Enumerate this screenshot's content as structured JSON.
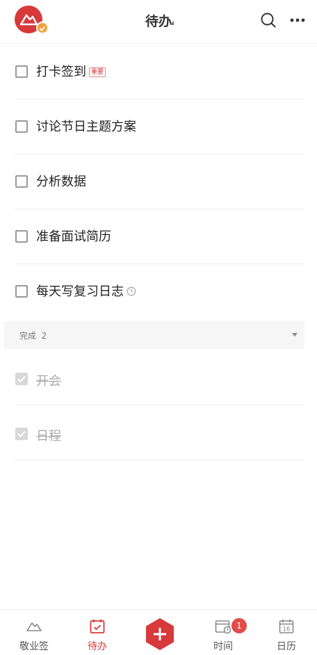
{
  "header": {
    "title": "待办"
  },
  "tasks": [
    {
      "label": "打卡签到",
      "tag": "重要"
    },
    {
      "label": "讨论节日主题方案"
    },
    {
      "label": "分析数据"
    },
    {
      "label": "准备面试简历"
    },
    {
      "label": "每天写复习日志",
      "icon": "clock-icon"
    }
  ],
  "completed": {
    "label": "完成",
    "count": "2",
    "items": [
      {
        "label": "开会"
      },
      {
        "label": "日程"
      }
    ]
  },
  "tabbar": {
    "items": [
      {
        "label": "敬业签",
        "icon": "mountain-icon"
      },
      {
        "label": "待办",
        "icon": "todo-calendar-icon",
        "active": true
      },
      {
        "label": "",
        "icon": "add-hexagon-icon"
      },
      {
        "label": "时间",
        "icon": "time-calendar-icon",
        "badge": "1"
      },
      {
        "label": "日历",
        "icon": "calendar-16-icon",
        "day": "16"
      }
    ]
  },
  "colors": {
    "accent": "#d8393b",
    "badge": "#e34a4a",
    "avatar_badge": "#f0a23a"
  }
}
